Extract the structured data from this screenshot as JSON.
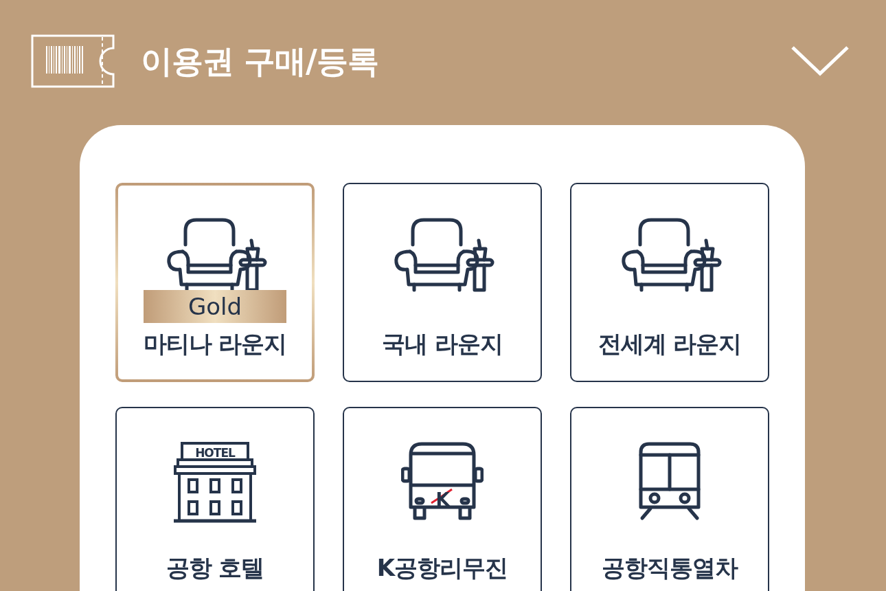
{
  "header": {
    "title": "이용권 구매/등록",
    "expanded": false
  },
  "tiles": [
    {
      "kind": "lounge",
      "label": "마티나 라운지",
      "badge": "Gold",
      "selected": true
    },
    {
      "kind": "lounge",
      "label": "국내 라운지",
      "selected": false
    },
    {
      "kind": "lounge",
      "label": "전세계 라운지",
      "selected": false
    },
    {
      "kind": "hotel",
      "label": "공항 호텔",
      "sign": "HOTEL",
      "selected": false
    },
    {
      "kind": "bus",
      "label": "K공항리무진",
      "sign": "K",
      "selected": false
    },
    {
      "kind": "train",
      "label": "공항직통열차",
      "selected": false
    }
  ]
}
